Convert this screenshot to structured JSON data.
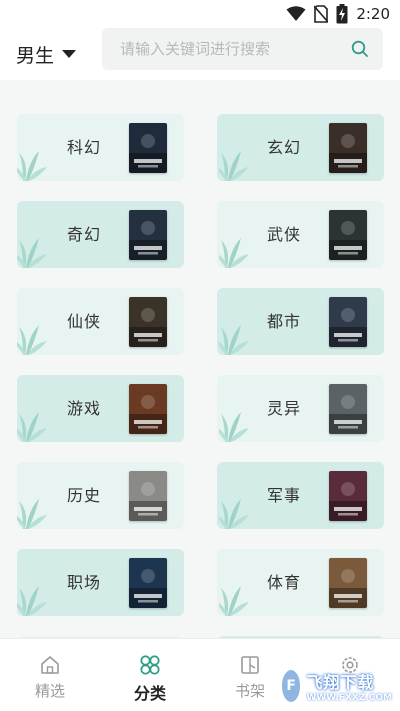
{
  "status_bar": {
    "time": "2:20"
  },
  "header": {
    "gender_label": "男生",
    "search_placeholder": "请输入关键词进行搜索"
  },
  "categories": [
    {
      "label": "科幻",
      "cover_color": "#1f2a3a"
    },
    {
      "label": "玄幻",
      "cover_color": "#3a2e28"
    },
    {
      "label": "奇幻",
      "cover_color": "#24303f"
    },
    {
      "label": "武侠",
      "cover_color": "#2c3433"
    },
    {
      "label": "仙侠",
      "cover_color": "#3b3328"
    },
    {
      "label": "都市",
      "cover_color": "#2f3a4a"
    },
    {
      "label": "游戏",
      "cover_color": "#6a3a22"
    },
    {
      "label": "灵异",
      "cover_color": "#5a6266"
    },
    {
      "label": "历史",
      "cover_color": "#8a8a86"
    },
    {
      "label": "军事",
      "cover_color": "#5a2b3b"
    },
    {
      "label": "职场",
      "cover_color": "#1e3550"
    },
    {
      "label": "体育",
      "cover_color": "#7a5a3a"
    }
  ],
  "tabbar": {
    "tabs": [
      {
        "label": "精选",
        "icon": "home-icon",
        "active": false
      },
      {
        "label": "分类",
        "icon": "clover-icon",
        "active": true
      },
      {
        "label": "书架",
        "icon": "bookshelf-icon",
        "active": false
      },
      {
        "label": "",
        "icon": "settings-icon",
        "active": false
      }
    ]
  },
  "watermark": {
    "main": "飞翔下载",
    "sub": "WWW.FXXZ.COM"
  },
  "colors": {
    "accent": "#2f9e88",
    "card_light": "#e8f4f2",
    "card_dark": "#d3ece7",
    "leaf": "#9fd3c7"
  }
}
